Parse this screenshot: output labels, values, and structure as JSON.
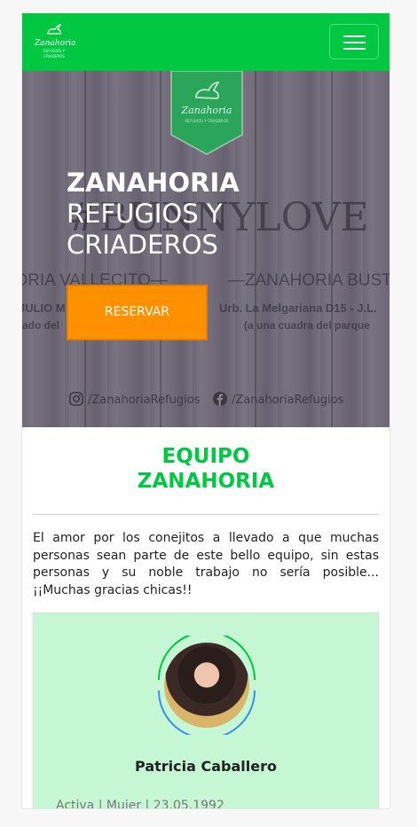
{
  "navbar": {
    "brand_name": "Zanahoria",
    "brand_tag": "REFUGIOS Y CRIADEROS",
    "menu_icon": "hamburger-icon"
  },
  "hero": {
    "badge_name": "Zanahoria",
    "badge_tag": "REFUGIOS Y CRIADEROS",
    "title_strong": "ZANAHORIA",
    "title_line1": "REFUGIOS Y",
    "title_line2": "CRIADEROS",
    "reserve_button": "RESERVAR",
    "instagram_handle": "/ZanahoriaRefugios",
    "facebook_handle": "/ZanahoriaRefugios",
    "bg_text": {
      "love": "#BUNNYLOVE",
      "left_name": "—ZANAHORIA VALLECITO—",
      "right_name": "—ZANAHORIA BUSTAMANTE",
      "left_addr": "JULIO M",
      "left_note": "tado del",
      "right_addr": "Urb. La Melgariana D15 - J.L.",
      "right_note": "(a una cuadra del parque"
    }
  },
  "team": {
    "title_line1": "EQUIPO",
    "title_line2": "ZANAHORIA",
    "intro": "El amor por los conejitos a llevado a que muchas personas sean parte de este bello equipo, sin estas personas y su noble trabajo no sería posible... ¡¡Muchas gracias chicas!!",
    "member": {
      "name": "Patricia Caballero",
      "meta": "Activa | Mujer | 23.05.1992"
    }
  },
  "colors": {
    "brand_green": "#00c841",
    "accent_orange": "#ff9100",
    "card_bg": "#c6f7d5"
  }
}
